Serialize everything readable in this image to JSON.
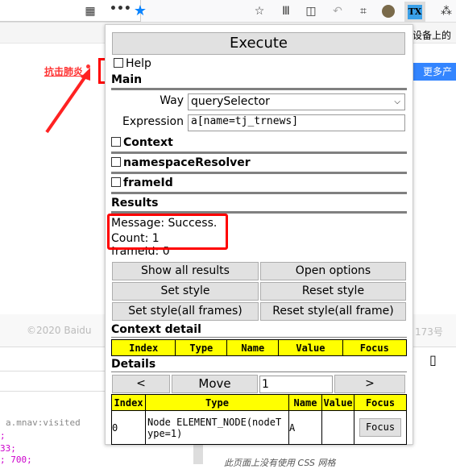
{
  "browser": {
    "icons": [
      "qr-code-icon",
      "more-icon",
      "bookmark-star-icon",
      "save-icon",
      "library-icon",
      "sidebar-icon",
      "undo-icon",
      "crop-icon",
      "avatar-icon",
      "tx-extension-icon",
      "extensions-icon"
    ],
    "tx_label": "TX",
    "right_text": "设备上的"
  },
  "page": {
    "link": "抗击肺炎",
    "more_products": "更多产品",
    "footer": "©2020 Baidu",
    "footer_right": "173号",
    "css_selector": "a.mnav:visited",
    "css_lines": [
      ";",
      "33;",
      "; 700;"
    ],
    "bottom_text": "此页面上没有使用 CSS 网格"
  },
  "popup": {
    "execute": "Execute",
    "help": "Help",
    "main": "Main",
    "way_label": "Way",
    "way_value": "querySelector",
    "expression_label": "Expression",
    "expression_value": "a[name=tj_trnews]",
    "context": "Context",
    "namespace": "namespaceResolver",
    "frameid": "frameId",
    "results": "Results",
    "message": "Message: Success.",
    "count": "Count: 1",
    "frameid_result": "frameId: 0",
    "buttons": [
      "Show all results",
      "Open options",
      "Set style",
      "Reset style",
      "Set style(all frames)",
      "Reset style(all frame)"
    ],
    "context_detail": "Context detail",
    "context_headers": [
      "Index",
      "Type",
      "Name",
      "Value",
      "Focus"
    ],
    "details": "Details",
    "prev": "<",
    "move": "Move",
    "move_value": "1",
    "next": ">",
    "detail_headers": [
      "Index",
      "Type",
      "Name",
      "Value",
      "Focus"
    ],
    "rows": [
      {
        "index": "0",
        "type": "Node ELEMENT_NODE(nodeType=1)",
        "name": "A",
        "value": "",
        "focus": "Focus"
      }
    ]
  },
  "colors": {
    "highlight": "#ff0000",
    "table_header": "#ffff00",
    "accent": "#3385ff"
  }
}
